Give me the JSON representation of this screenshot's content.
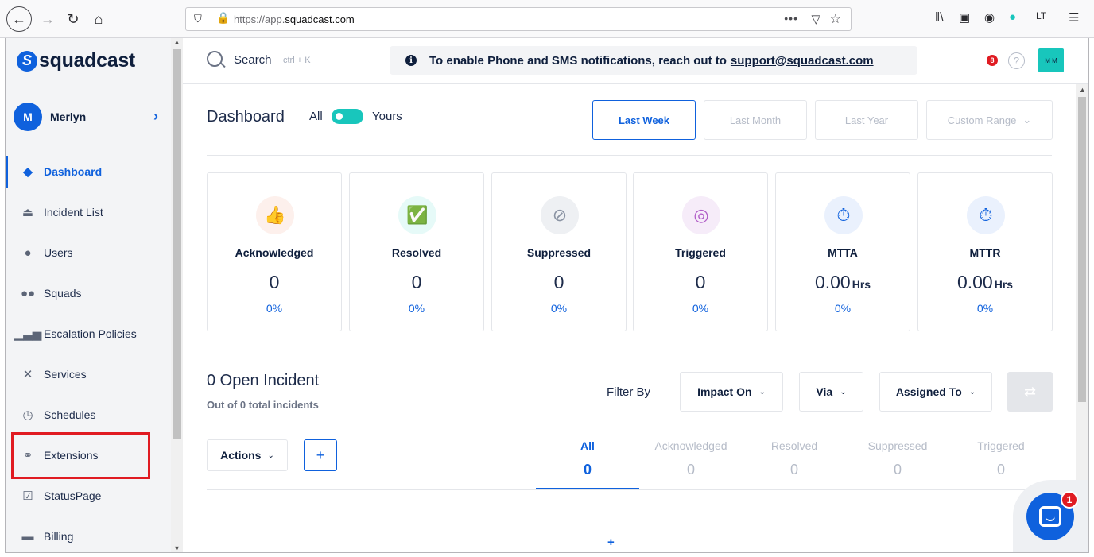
{
  "browser": {
    "url_prefix": "https://app.",
    "url_domain": "squadcast.com",
    "back_icon": "←",
    "forward_icon": "→",
    "reload_icon": "↻",
    "home_icon": "⌂"
  },
  "sidebar": {
    "brand": "squadcast",
    "profile": {
      "initial": "M",
      "name": "Merlyn"
    },
    "items": [
      {
        "label": "Dashboard",
        "icon": "layers-icon",
        "active": true
      },
      {
        "label": "Incident List",
        "icon": "siren-icon"
      },
      {
        "label": "Users",
        "icon": "user-icon"
      },
      {
        "label": "Squads",
        "icon": "group-icon"
      },
      {
        "label": "Escalation Policies",
        "icon": "bars-icon"
      },
      {
        "label": "Services",
        "icon": "tools-icon"
      },
      {
        "label": "Schedules",
        "icon": "clock-icon"
      },
      {
        "label": "Extensions",
        "icon": "link-icon"
      },
      {
        "label": "StatusPage",
        "icon": "checklist-icon"
      },
      {
        "label": "Billing",
        "icon": "card-icon"
      }
    ]
  },
  "header": {
    "search_label": "Search",
    "search_shortcut": "ctrl + K",
    "banner_text": "To enable Phone and SMS notifications, reach out to",
    "banner_link": "support@squadcast.com",
    "notification_count": "8",
    "help": "?",
    "user_initials": "M M"
  },
  "dashboard": {
    "title": "Dashboard",
    "toggle_all": "All",
    "toggle_yours": "Yours",
    "ranges": [
      "Last Week",
      "Last Month",
      "Last Year",
      "Custom Range"
    ],
    "custom_range_chevron": "⌄",
    "cards": [
      {
        "title": "Acknowledged",
        "value": "0",
        "unit": "",
        "pct": "0%",
        "icon": "thumbs-up-icon",
        "color": "#e8684a"
      },
      {
        "title": "Resolved",
        "value": "0",
        "unit": "",
        "pct": "0%",
        "icon": "check-siren-icon",
        "color": "#18c6bc"
      },
      {
        "title": "Suppressed",
        "value": "0",
        "unit": "",
        "pct": "0%",
        "icon": "muted-siren-icon",
        "color": "#8a93a3"
      },
      {
        "title": "Triggered",
        "value": "0",
        "unit": "",
        "pct": "0%",
        "icon": "target-icon",
        "color": "#b05cc7"
      },
      {
        "title": "MTTA",
        "value": "0.00",
        "unit": "Hrs",
        "pct": "0%",
        "icon": "stopwatch-icon",
        "color": "#0f61dd"
      },
      {
        "title": "MTTR",
        "value": "0.00",
        "unit": "Hrs",
        "pct": "0%",
        "icon": "stopwatch-icon",
        "color": "#0f61dd"
      }
    ]
  },
  "incidents": {
    "title": "0 Open Incident",
    "subtitle": "Out of 0 total incidents",
    "filter_label": "Filter By",
    "filters": [
      "Impact On",
      "Via",
      "Assigned To"
    ],
    "actions_label": "Actions",
    "add_label": "+",
    "tabs": [
      {
        "label": "All",
        "count": "0",
        "active": true
      },
      {
        "label": "Acknowledged",
        "count": "0"
      },
      {
        "label": "Resolved",
        "count": "0"
      },
      {
        "label": "Suppressed",
        "count": "0"
      },
      {
        "label": "Triggered",
        "count": "0"
      }
    ],
    "plus_marker": "+"
  },
  "chat": {
    "unread": "1"
  },
  "colors": {
    "brand": "#0f61dd",
    "teal": "#18c6bc",
    "highlight": "#e01b22"
  }
}
